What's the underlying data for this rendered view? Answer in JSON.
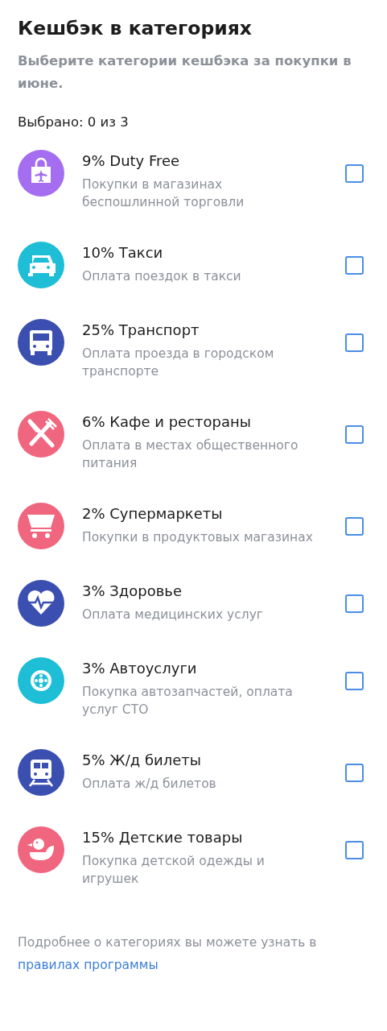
{
  "title": "Кешбэк в категориях",
  "subtitle": "Выберите категории кешбэка за покупки в июне.",
  "selected_count": "Выбрано: 0 из 3",
  "categories": [
    {
      "kind": "bag",
      "color": "#a56ef0",
      "name": "9% Duty Free",
      "description": "Покупки в магазинах беспошлинной торговли",
      "checked": false
    },
    {
      "kind": "car",
      "color": "#1dbed6",
      "name": "10% Такси",
      "description": "Оплата поездок в такси",
      "checked": false
    },
    {
      "kind": "bus",
      "color": "#3b4fb0",
      "name": "25% Транспорт",
      "description": "Оплата проезда в городском транспорте",
      "checked": false
    },
    {
      "kind": "cutlery",
      "color": "#f0667f",
      "name": "6% Кафе и рестораны",
      "description": "Оплата в местах общественного питания",
      "checked": false
    },
    {
      "kind": "cart",
      "color": "#f0667f",
      "name": "2% Супермаркеты",
      "description": "Покупки в продуктовых магазинах",
      "checked": false
    },
    {
      "kind": "heart",
      "color": "#3b4fb0",
      "name": "3% Здоровье",
      "description": "Оплата медицинских услуг",
      "checked": false
    },
    {
      "kind": "wheel",
      "color": "#1dbed6",
      "name": "3% Автоуслуги",
      "description": "Покупка автозапчастей, оплата услуг СТО",
      "checked": false
    },
    {
      "kind": "train",
      "color": "#3b4fb0",
      "name": "5% Ж/д билеты",
      "description": "Оплата ж/д билетов",
      "checked": false
    },
    {
      "kind": "duck",
      "color": "#f0667f",
      "name": "15% Детские товары",
      "description": "Покупка детской одежды и игрушек",
      "checked": false
    }
  ],
  "footer": {
    "text": "Подробнее о категориях вы можете узнать в",
    "link": "правилах программы"
  }
}
